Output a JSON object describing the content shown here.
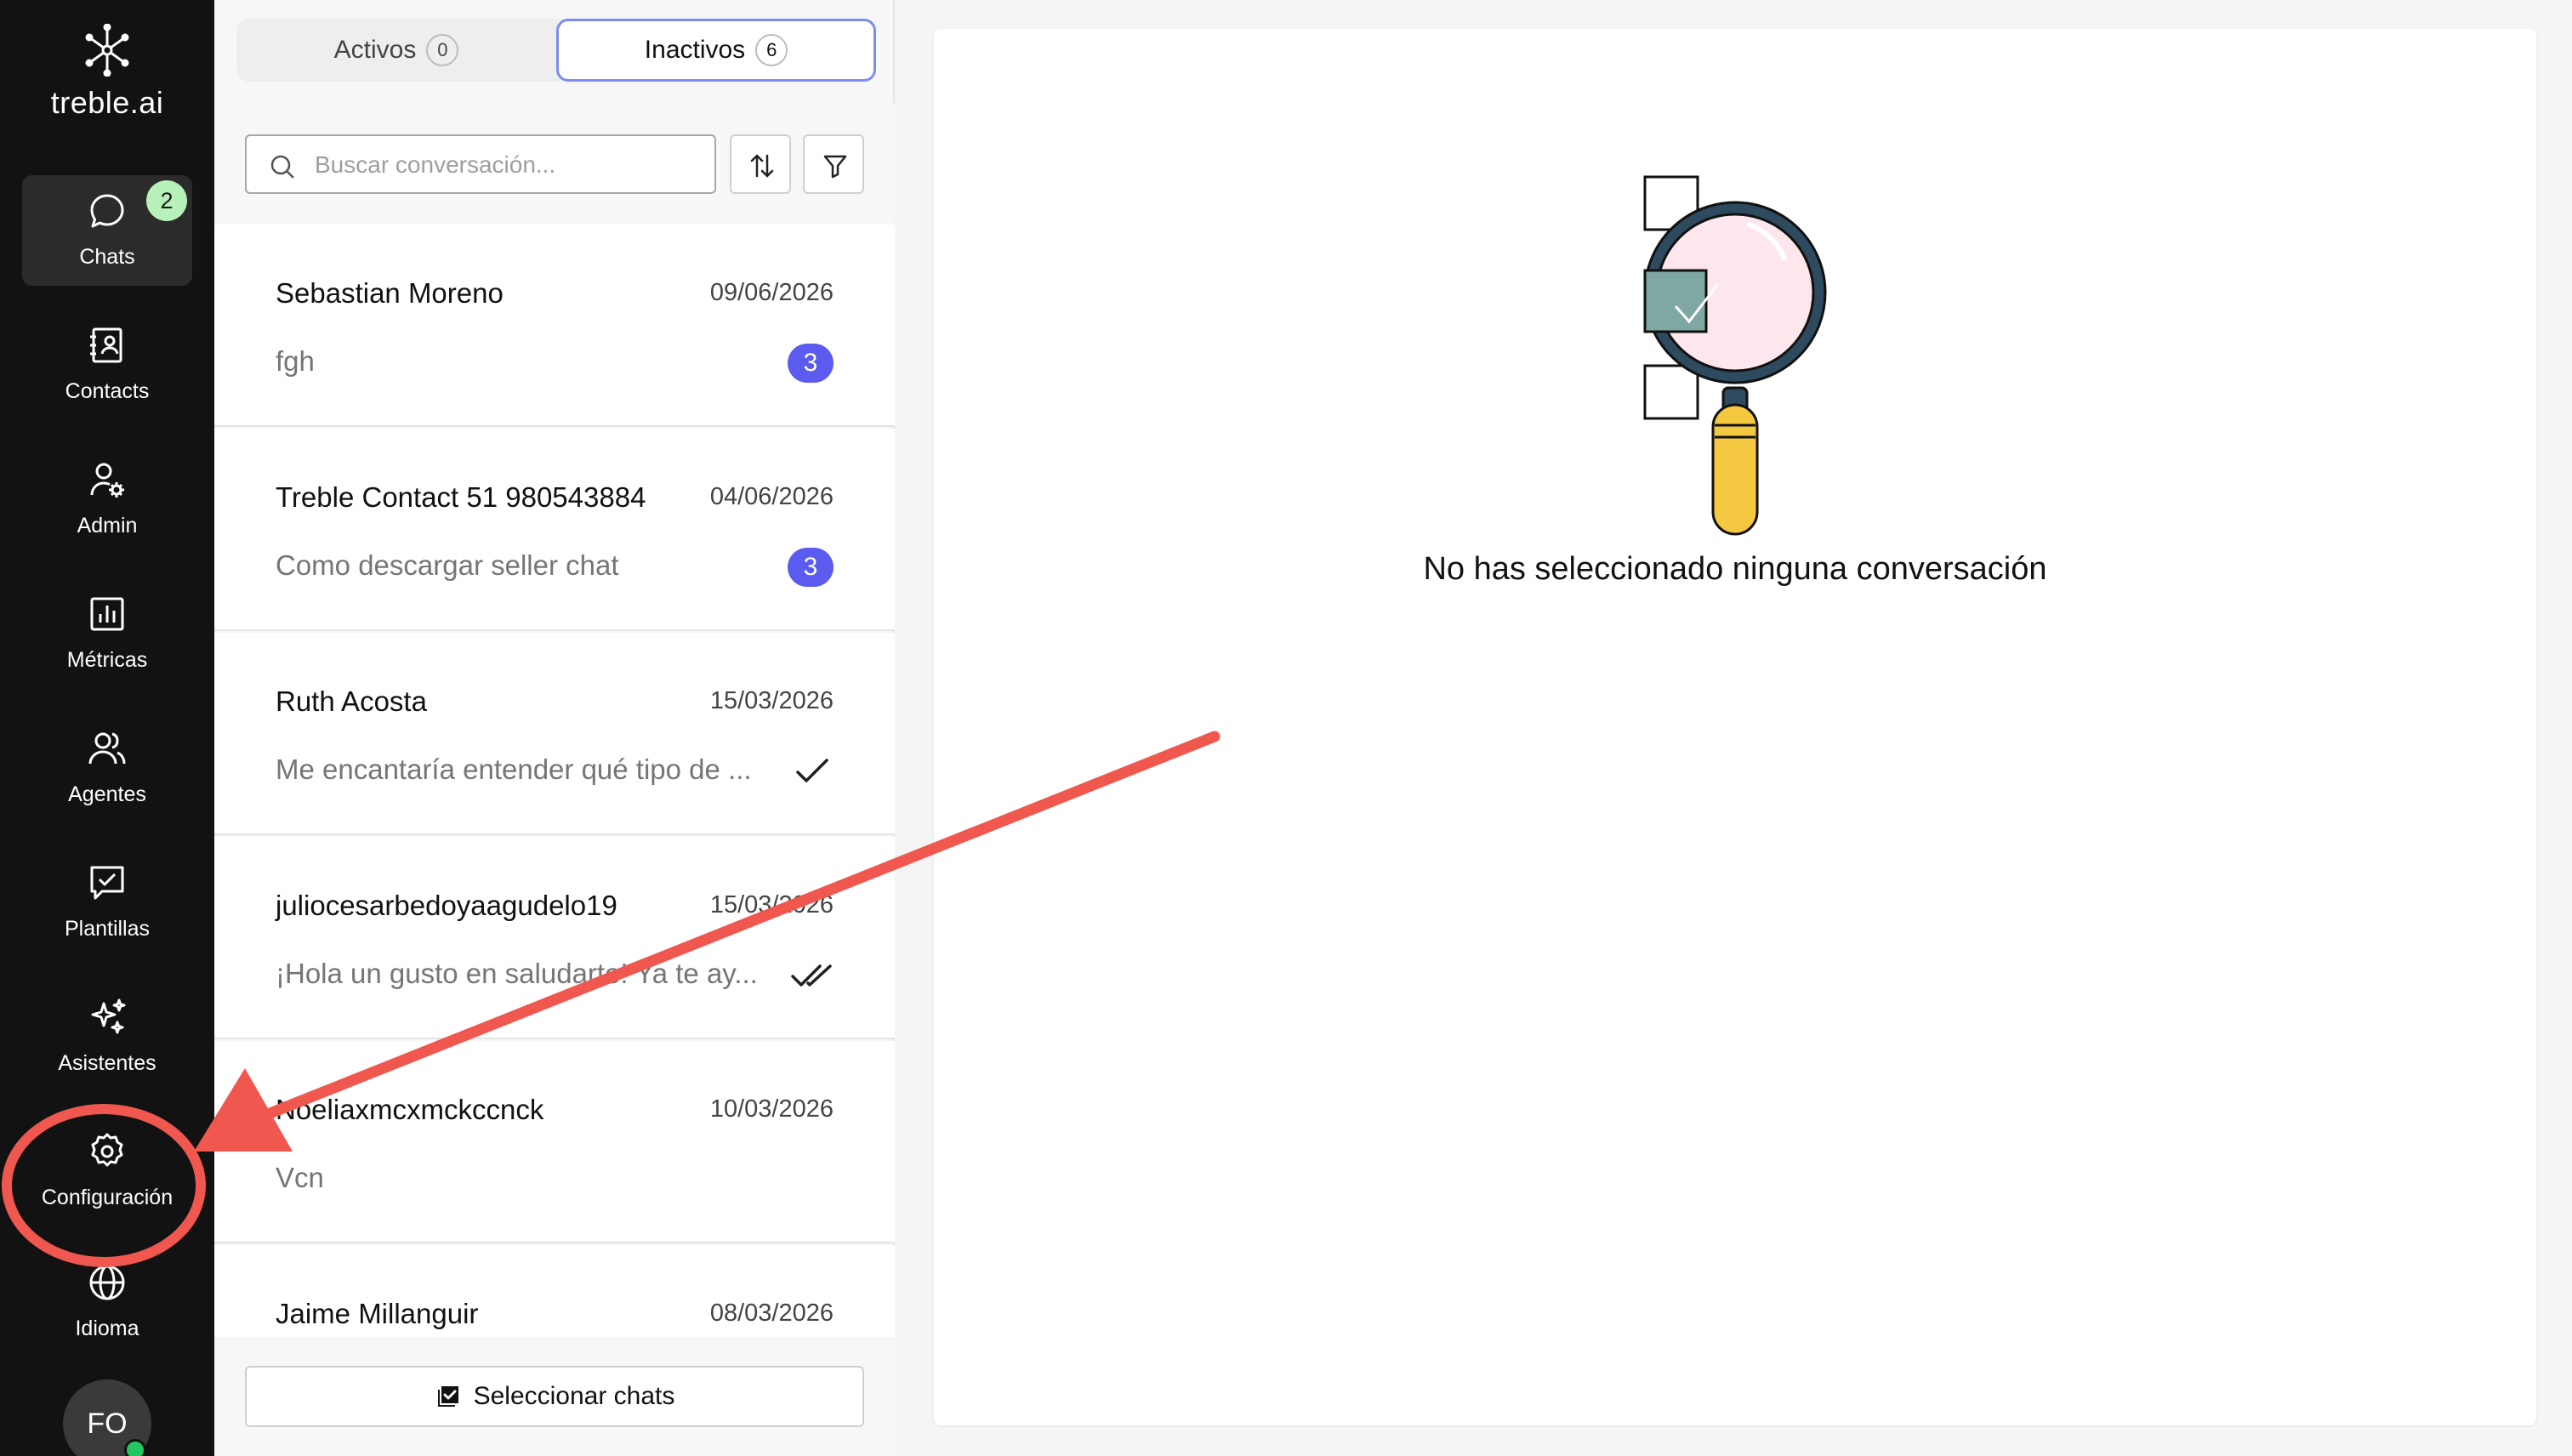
{
  "app": {
    "logo_text": "treble.ai"
  },
  "sidebar": {
    "items": [
      {
        "label": "Chats",
        "icon": "chat-bubble-icon",
        "badge": "2",
        "active": true
      },
      {
        "label": "Contacts",
        "icon": "contact-book-icon"
      },
      {
        "label": "Admin",
        "icon": "user-gear-icon"
      },
      {
        "label": "Métricas",
        "icon": "bar-chart-icon"
      },
      {
        "label": "Agentes",
        "icon": "users-icon"
      },
      {
        "label": "Plantillas",
        "icon": "template-check-icon"
      },
      {
        "label": "Asistentes",
        "icon": "sparkles-icon"
      },
      {
        "label": "Configuración",
        "icon": "gear-icon"
      },
      {
        "label": "Idioma",
        "icon": "globe-icon"
      }
    ],
    "avatar_initials": "FO"
  },
  "tabs": [
    {
      "label": "Activos",
      "count": "0"
    },
    {
      "label": "Inactivos",
      "count": "6",
      "selected": true
    }
  ],
  "search": {
    "placeholder": "Buscar conversación..."
  },
  "conversations": [
    {
      "name": "Sebastian Moreno",
      "date": "09/06/2026",
      "message": "fgh",
      "unread": "3"
    },
    {
      "name": "Treble Contact 51 980543884",
      "date": "04/06/2026",
      "message": "Como descargar seller chat",
      "unread": "3"
    },
    {
      "name": "Ruth Acosta",
      "date": "15/03/2026",
      "message": "Me encantaría entender qué tipo de ...",
      "status": "single-check"
    },
    {
      "name": "juliocesarbedoyaagudelo19",
      "date": "15/03/2026",
      "message": "¡Hola un gusto en saludarte! Ya te ay...",
      "status": "double-check"
    },
    {
      "name": "Noeliaxmcxmckccnck",
      "date": "10/03/2026",
      "message": "Vcn"
    },
    {
      "name": "Jaime Millanguir",
      "date": "08/03/2026",
      "message": ""
    }
  ],
  "select_chats_label": "Seleccionar chats",
  "empty_state": {
    "text": "No has seleccionado ninguna conversación"
  },
  "colors": {
    "sidebar_bg": "#121212",
    "accent_badge": "#5b5bf0",
    "chat_badge": "#b7f0b8",
    "annotation": "#f0584f",
    "online": "#22c55e"
  }
}
